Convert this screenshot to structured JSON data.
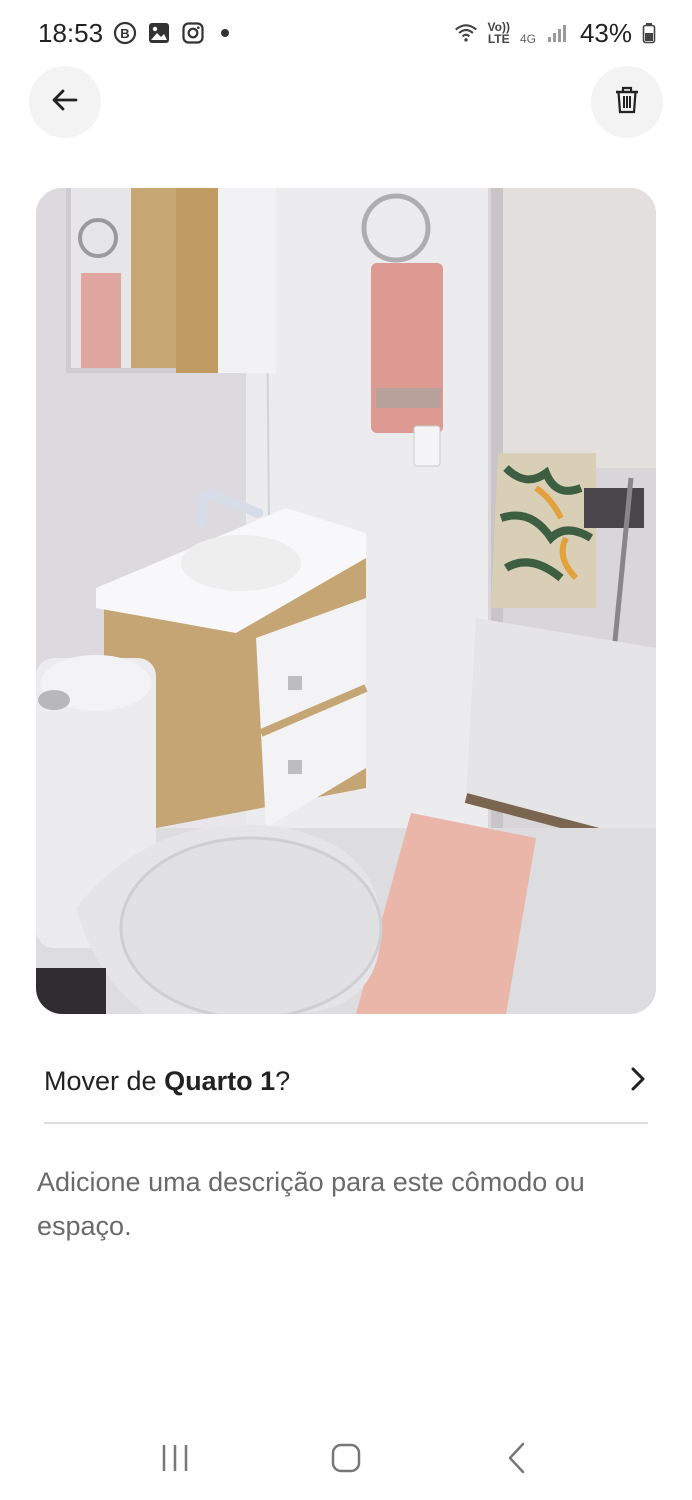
{
  "status_bar": {
    "time": "18:53",
    "battery_percent": "43%",
    "network_top": "Vo))",
    "network_bottom": "LTE",
    "network_type": "4G",
    "icons": [
      "b-badge-icon",
      "gallery-icon",
      "instagram-icon",
      "wifi-icon",
      "signal-icon",
      "battery-icon"
    ]
  },
  "header": {
    "back_icon": "arrow-left-icon",
    "delete_icon": "trash-icon"
  },
  "photo": {
    "subject": "bathroom"
  },
  "move_row": {
    "prefix": "Mover de ",
    "room": "Quarto 1",
    "suffix": "?",
    "chevron_icon": "chevron-right-icon"
  },
  "description_placeholder": "Adicione uma descrição para este cômodo ou espaço.",
  "nav_bar": {
    "icons": [
      "recent-apps-icon",
      "home-icon",
      "back-icon"
    ]
  },
  "colors": {
    "background": "#ffffff",
    "button_bg": "#f3f3f3",
    "text_primary": "#222222",
    "text_secondary": "#6a6a6a",
    "divider": "#dddddd"
  }
}
